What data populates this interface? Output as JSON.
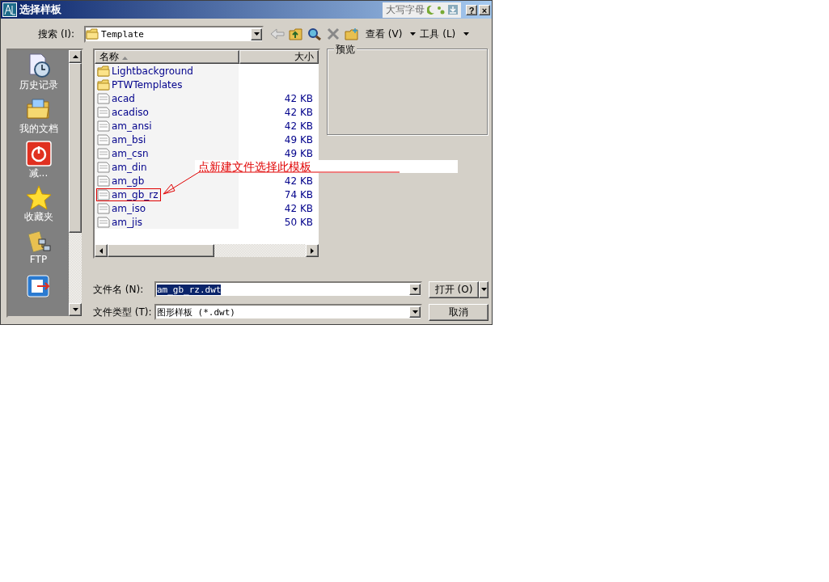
{
  "window": {
    "title": "选择样板",
    "ime_status": "大写字母",
    "title_buttons": [
      "?",
      "×"
    ]
  },
  "toolbar": {
    "search_label": "搜索 (I):",
    "location": "Template",
    "view_menu": "查看 (V)",
    "tools_menu": "工具 (L)"
  },
  "places": [
    {
      "label": "历史记录",
      "kind": "history"
    },
    {
      "label": "我的文档",
      "kind": "documents"
    },
    {
      "label": "减...",
      "kind": "power"
    },
    {
      "label": "收藏夹",
      "kind": "star"
    },
    {
      "label": "FTP",
      "kind": "ftp"
    },
    {
      "kind": "exit"
    }
  ],
  "file_list": {
    "columns": [
      "名称",
      "大小"
    ],
    "rows": [
      {
        "name": "Lightbackground",
        "kind": "folder",
        "boxed": false
      },
      {
        "name": "PTWTemplates",
        "kind": "folder",
        "boxed": false
      },
      {
        "name": "acad",
        "size": "42 KB",
        "kind": "dwt",
        "boxed": false
      },
      {
        "name": "acadiso",
        "size": "42 KB",
        "kind": "dwt",
        "boxed": false
      },
      {
        "name": "am_ansi",
        "size": "42 KB",
        "kind": "dwt",
        "boxed": false
      },
      {
        "name": "am_bsi",
        "size": "49 KB",
        "kind": "dwt",
        "boxed": false
      },
      {
        "name": "am_csn",
        "size": "49 KB",
        "kind": "dwt",
        "boxed": false
      },
      {
        "name": "am_din",
        "kind": "dwt",
        "boxed": false
      },
      {
        "name": "am_gb",
        "size": "42 KB",
        "kind": "dwt",
        "boxed": false
      },
      {
        "name": "am_gb_rz",
        "size": "74 KB",
        "kind": "dwt",
        "boxed": true
      },
      {
        "name": "am_iso",
        "size": "42 KB",
        "kind": "dwt",
        "boxed": false
      },
      {
        "name": "am_jis",
        "size": "50 KB",
        "kind": "dwt",
        "boxed": false
      }
    ]
  },
  "preview": {
    "label": "预览"
  },
  "file_name": {
    "label": "文件名 (N):",
    "value": "am_gb_rz.dwt"
  },
  "file_type": {
    "label": "文件类型 (T):",
    "value": "图形样板 (*.dwt)"
  },
  "buttons": {
    "open": "打开 (O)",
    "cancel": "取消"
  },
  "annotation": {
    "text": "点新建文件选择此模板"
  }
}
